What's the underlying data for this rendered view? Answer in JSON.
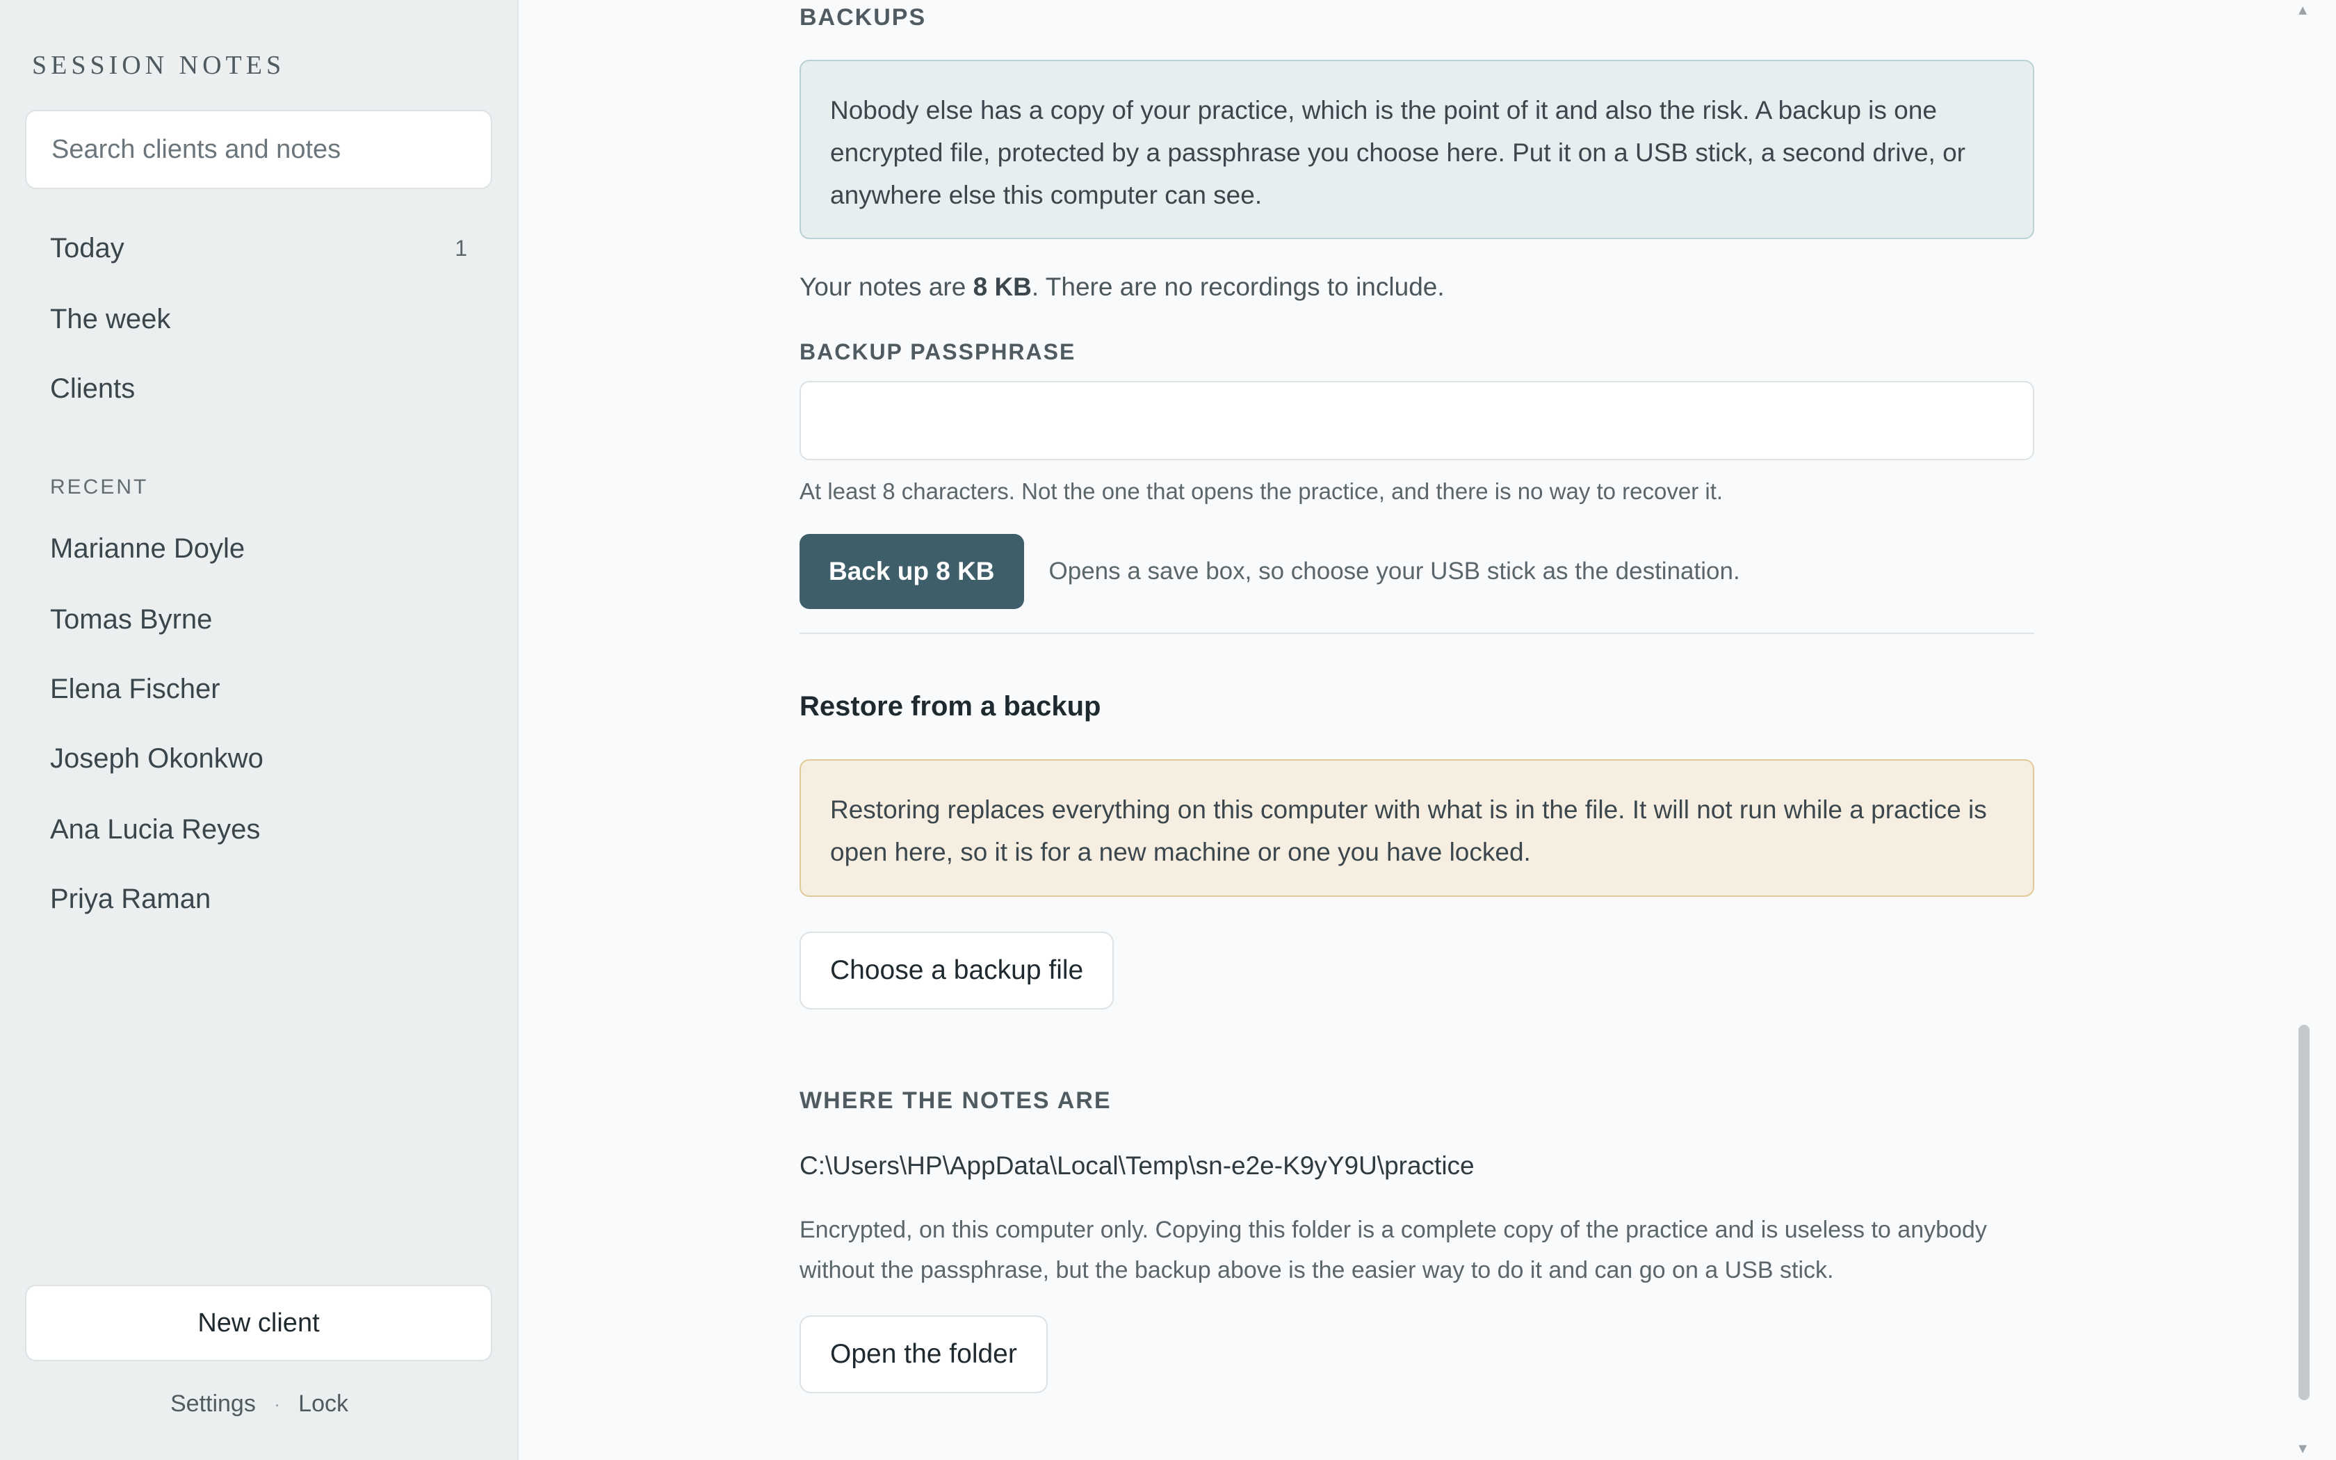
{
  "sidebar": {
    "brand": "SESSION NOTES",
    "search_placeholder": "Search clients and notes",
    "nav": [
      {
        "label": "Today",
        "count": "1"
      },
      {
        "label": "The week",
        "count": ""
      },
      {
        "label": "Clients",
        "count": ""
      }
    ],
    "recent_label": "RECENT",
    "recent": [
      {
        "label": "Marianne Doyle"
      },
      {
        "label": "Tomas Byrne"
      },
      {
        "label": "Elena Fischer"
      },
      {
        "label": "Joseph Okonkwo"
      },
      {
        "label": "Ana Lucia Reyes"
      },
      {
        "label": "Priya Raman"
      }
    ],
    "new_client": "New client",
    "settings": "Settings",
    "separator": "·",
    "lock": "Lock"
  },
  "backups": {
    "heading": "BACKUPS",
    "info": "Nobody else has a copy of your practice, which is the point of it and also the risk. A backup is one encrypted file, protected by a passphrase you choose here. Put it on a USB stick, a second drive, or anywhere else this computer can see.",
    "size_prefix": "Your notes are ",
    "size_value": "8 KB",
    "size_suffix": ". There are no recordings to include.",
    "passphrase_label": "BACKUP PASSPHRASE",
    "passphrase_value": "",
    "passphrase_hint": "At least 8 characters. Not the one that opens the practice, and there is no way to recover it.",
    "backup_button": "Back up 8 KB",
    "backup_hint": "Opens a save box, so choose your USB stick as the destination."
  },
  "restore": {
    "title": "Restore from a backup",
    "warning": "Restoring replaces everything on this computer with what is in the file. It will not run while a practice is open here, so it is for a new machine or one you have locked.",
    "choose_button": "Choose a backup file"
  },
  "location": {
    "heading": "WHERE THE NOTES ARE",
    "path": "C:\\Users\\HP\\AppData\\Local\\Temp\\sn-e2e-K9yY9U\\practice",
    "description": "Encrypted, on this computer only. Copying this folder is a complete copy of the practice and is useless to anybody without the passphrase, but the backup above is the easier way to do it and can go on a USB stick.",
    "open_button": "Open the folder"
  },
  "colors": {
    "primary": "#3e5e69",
    "info_bg": "#e6eeef",
    "warn_bg": "#f6efe1",
    "sidebar_bg": "#eceff0"
  }
}
